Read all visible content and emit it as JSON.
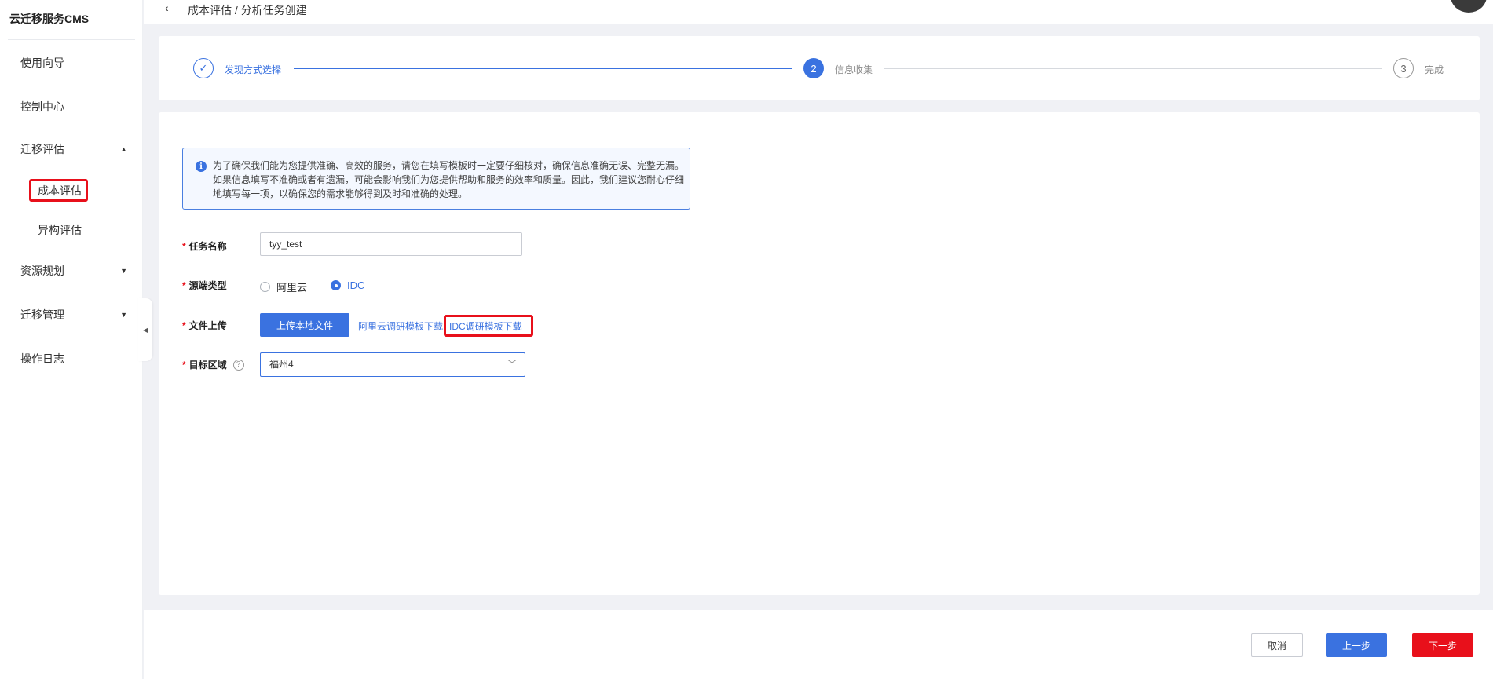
{
  "sidebar": {
    "title": "云迁移服务CMS",
    "items": [
      {
        "label": "使用向导"
      },
      {
        "label": "控制中心"
      },
      {
        "label": "迁移评估",
        "sub": [
          "成本评估",
          "异构评估"
        ]
      },
      {
        "label": "资源规划"
      },
      {
        "label": "迁移管理"
      },
      {
        "label": "操作日志"
      }
    ]
  },
  "header": {
    "breadcrumb": "成本评估 / 分析任务创建"
  },
  "steps": [
    {
      "num": "✓",
      "label": "发现方式选择",
      "status": "done"
    },
    {
      "num": "2",
      "label": "信息收集",
      "status": "active"
    },
    {
      "num": "3",
      "label": "完成",
      "status": "wait"
    }
  ],
  "notice": {
    "text": "为了确保我们能为您提供准确、高效的服务，请您在填写模板时一定要仔细核对，确保信息准确无误、完整无漏。如果信息填写不准确或者有遗漏，可能会影响我们为您提供帮助和服务的效率和质量。因此，我们建议您耐心仔细地填写每一项，以确保您的需求能够得到及时和准确的处理。"
  },
  "form": {
    "task_name_label": "任务名称",
    "task_name_value": "tyy_test",
    "source_type_label": "源端类型",
    "source_options": [
      "阿里云",
      "IDC"
    ],
    "source_selected": "IDC",
    "upload_label": "文件上传",
    "upload_button": "上传本地文件",
    "aliyun_template_link": "阿里云调研模板下载",
    "idc_template_link": "IDC调研模板下载",
    "region_label": "目标区域",
    "region_value": "福州4"
  },
  "footer": {
    "cancel": "取消",
    "prev": "上一步",
    "next": "下一步"
  },
  "colors": {
    "primary": "#3a72e0",
    "danger": "#e8101b"
  }
}
